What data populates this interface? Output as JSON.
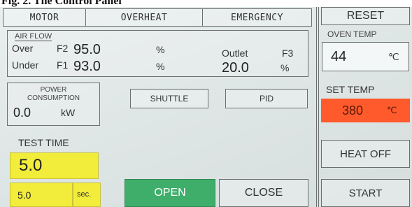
{
  "caption": "Fig. 2. The Control Panel",
  "top_tabs": {
    "motor": "MOTOR",
    "overheat": "OVERHEAT",
    "emergency": "EMERGENCY"
  },
  "air_flow": {
    "title": "AIR FLOW",
    "over_label": "Over",
    "over_code": "F2",
    "over_value": "95.0",
    "over_unit": "%",
    "under_label": "Under",
    "under_code": "F1",
    "under_value": "93.0",
    "under_unit": "%",
    "outlet_label": "Outlet",
    "outlet_code": "F3",
    "outlet_value": "20.0",
    "outlet_unit": "%"
  },
  "power": {
    "title_line1": "POWER",
    "title_line2": "CONSUMPTION",
    "value": "0.0",
    "unit": "kW"
  },
  "buttons": {
    "shuttle": "SHUTTLE",
    "pid": "PID",
    "open": "OPEN",
    "close": "CLOSE"
  },
  "test_time": {
    "title": "TEST TIME",
    "value": "5.0",
    "setpoint": "5.0",
    "unit": "sec."
  },
  "right_panel": {
    "reset": "RESET",
    "oven_temp_label": "OVEN TEMP",
    "oven_temp_value": "44",
    "oven_temp_unit": "℃",
    "set_temp_label": "SET TEMP",
    "set_temp_value": "380",
    "set_temp_unit": "℃",
    "heat_off": "HEAT OFF",
    "start": "START"
  },
  "colors": {
    "yellow": "#f2ec3a",
    "green": "#3fae6a",
    "orange_red": "#ff5a2c",
    "panel_bg": "#e3e9e9"
  }
}
